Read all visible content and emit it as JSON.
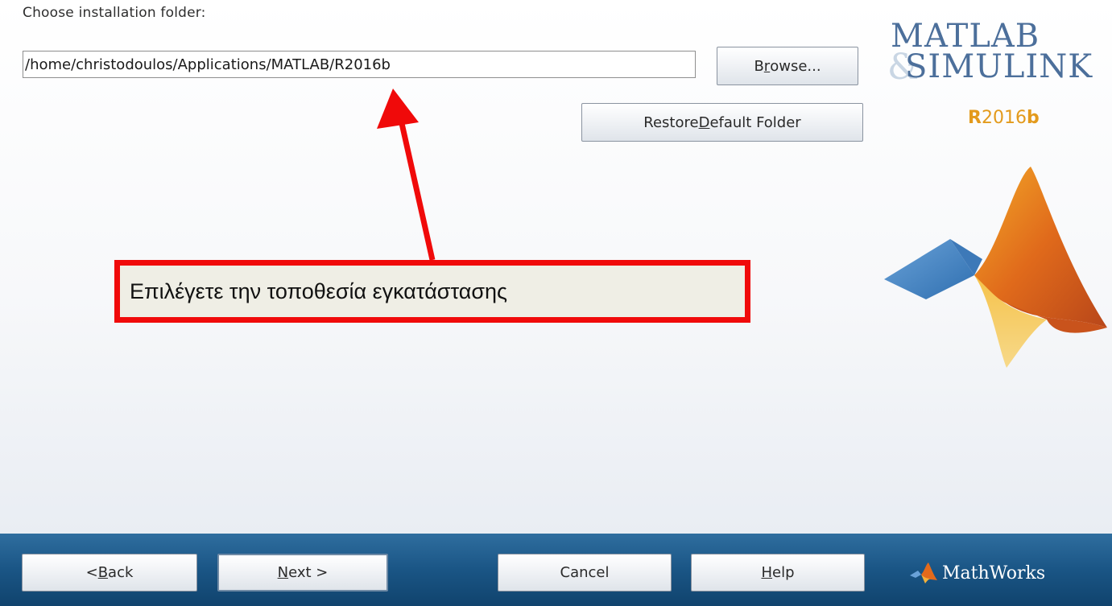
{
  "installer": {
    "folder_label": "Choose installation folder:",
    "path_value": "/home/christodoulos/Applications/MATLAB/R2016b",
    "browse_label_pre": "B",
    "browse_label_key": "r",
    "browse_label_post": "owse...",
    "restore_label_pre": "Restore ",
    "restore_label_key": "D",
    "restore_label_post": "efault Folder"
  },
  "branding": {
    "product_line1": "MATLAB",
    "product_ampersand": "&",
    "product_line2": "SIMULINK",
    "release_r": "R",
    "release_year": "2016",
    "release_letter": "b",
    "vendor": "MathWorks",
    "accent_blue": "#4c6f9b",
    "accent_orange": "#e39a1c"
  },
  "annotation": {
    "callout_text": "Επιλέγετε την τοποθεσία εγκατάστασης",
    "color": "#f00a0a"
  },
  "footer": {
    "back_pre": "< ",
    "back_key": "B",
    "back_post": "ack",
    "next_key": "N",
    "next_post": "ext >",
    "cancel_label": "Cancel",
    "help_key": "H",
    "help_post": "elp"
  }
}
